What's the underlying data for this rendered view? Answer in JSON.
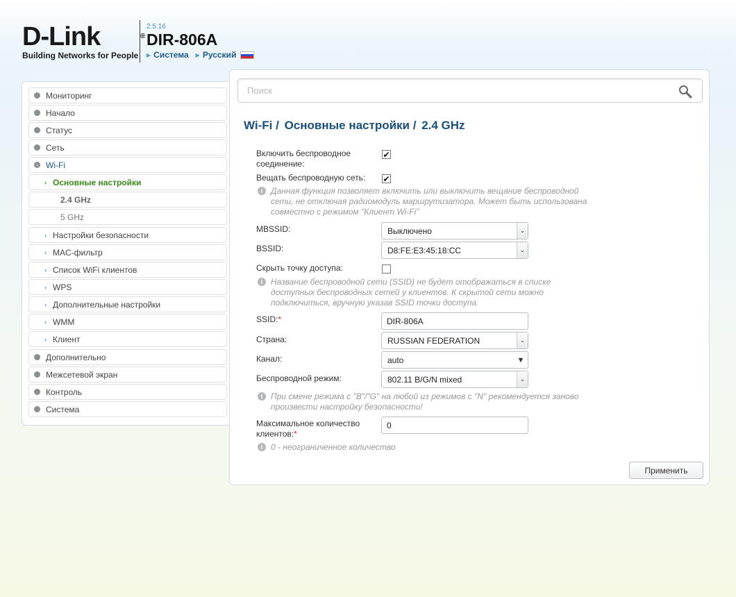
{
  "header": {
    "logo": "D-Link",
    "logo_mark": "®",
    "tagline": "Building Networks for People",
    "firmware": "2.5.16",
    "model": "DIR-806A",
    "link_system": "Система",
    "link_language": "Русский"
  },
  "sidebar": {
    "items": [
      {
        "label": "Мониторинг"
      },
      {
        "label": "Начало"
      },
      {
        "label": "Статус"
      },
      {
        "label": "Сеть"
      },
      {
        "label": "Wi-Fi"
      },
      {
        "label": "Основные настройки"
      },
      {
        "label": "2.4 GHz"
      },
      {
        "label": "5 GHz"
      },
      {
        "label": "Настройки безопасности"
      },
      {
        "label": "MAC-фильтр"
      },
      {
        "label": "Список WiFi клиентов"
      },
      {
        "label": "WPS"
      },
      {
        "label": "Дополнительные настройки"
      },
      {
        "label": "WMM"
      },
      {
        "label": "Клиент"
      },
      {
        "label": "Дополнительно"
      },
      {
        "label": "Межсетевой экран"
      },
      {
        "label": "Контроль"
      },
      {
        "label": "Система"
      }
    ]
  },
  "search": {
    "placeholder": "Поиск"
  },
  "title": {
    "part1": "Wi-Fi /",
    "part2": "Основные настройки /",
    "part3": "2.4 GHz"
  },
  "form": {
    "enable_label_1": "Включить беспроводное",
    "enable_label_2": "соединение:",
    "broadcast_label": "Вещать беспроводную сеть:",
    "broadcast_hint_1": "Данная функция позволяет включить или выключить вещание беспроводной",
    "broadcast_hint_2": "сети, не отключая радиомодуль маршрутизатора. Может быть использована",
    "broadcast_hint_3": "совместно с режимом \"Клиент Wi-Fi\"",
    "mbssid_label": "MBSSID:",
    "mbssid_value": "Выключено",
    "bssid_label": "BSSID:",
    "bssid_value": "D8:FE:E3:45:18:CC",
    "hide_label": "Скрыть точку доступа:",
    "hide_hint_1": "Название беспроводной сети (SSID) не будет отображаться в списке",
    "hide_hint_2": "доступных беспроводных сетей у клиентов. К скрытой сети можно",
    "hide_hint_3": "подключиться, вручную указав SSID точки доступа.",
    "ssid_label": "SSID:",
    "ssid_value": "DIR-806A",
    "country_label": "Страна:",
    "country_value": "RUSSIAN FEDERATION",
    "channel_label": "Канал:",
    "channel_value": "auto",
    "mode_label": "Беспроводной режим:",
    "mode_value": "802.11 B/G/N mixed",
    "mode_hint_1": "При смене режима с \"B\"/\"G\" на любой из режимов с \"N\" рекомендуется заново",
    "mode_hint_2": "произвести настройку безопасности!",
    "maxclients_label_1": "Максимальное количество",
    "maxclients_label_2": "клиентов:",
    "maxclients_value": "0",
    "maxclients_hint": "0 - неограниченное количество",
    "required_mark": "*"
  },
  "apply_label": "Применить",
  "checks": {
    "enable": true,
    "broadcast": true,
    "hide": false
  },
  "icons": {
    "hint": "info-icon",
    "search": "magnifier-icon"
  }
}
